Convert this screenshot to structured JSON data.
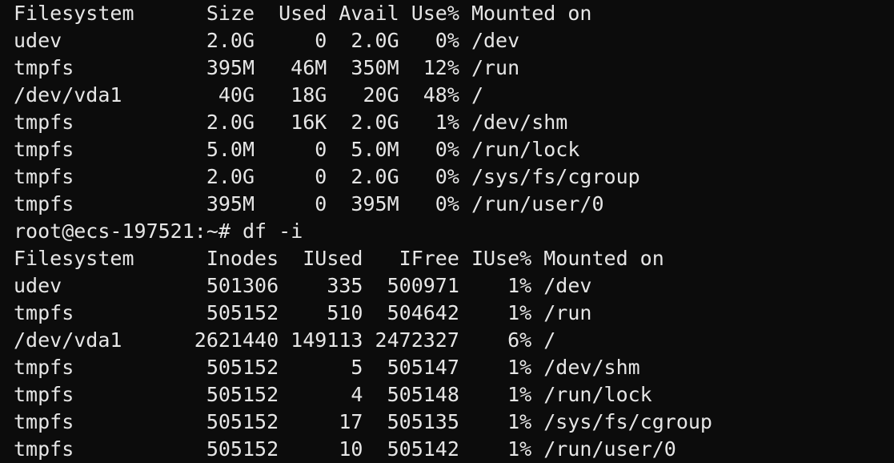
{
  "terminal": {
    "df_header": "Filesystem      Size  Used Avail Use% Mounted on",
    "df_rows": [
      "udev            2.0G     0  2.0G   0% /dev",
      "tmpfs           395M   46M  350M  12% /run",
      "/dev/vda1        40G   18G   20G  48% /",
      "tmpfs           2.0G   16K  2.0G   1% /dev/shm",
      "tmpfs           5.0M     0  5.0M   0% /run/lock",
      "tmpfs           2.0G     0  2.0G   0% /sys/fs/cgroup",
      "tmpfs           395M     0  395M   0% /run/user/0"
    ],
    "prompt": "root@ecs-197521:~# ",
    "command": "df -i",
    "dfi_header": "Filesystem      Inodes  IUsed   IFree IUse% Mounted on",
    "dfi_rows": [
      "udev            501306    335  500971    1% /dev",
      "tmpfs           505152    510  504642    1% /run",
      "/dev/vda1      2621440 149113 2472327    6% /",
      "tmpfs           505152      5  505147    1% /dev/shm",
      "tmpfs           505152      4  505148    1% /run/lock",
      "tmpfs           505152     17  505135    1% /sys/fs/cgroup",
      "tmpfs           505152     10  505142    1% /run/user/0"
    ]
  }
}
